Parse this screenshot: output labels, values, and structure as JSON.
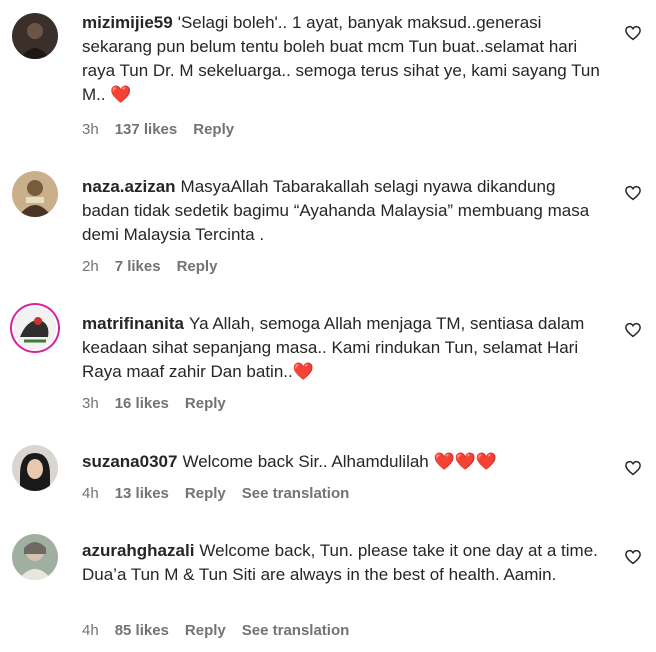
{
  "comments": [
    {
      "username": "mizimijie59",
      "text": "'Selagi boleh'.. 1 ayat, banyak maksud..generasi sekarang pun belum tentu boleh buat mcm Tun buat..selamat hari raya Tun Dr. M sekeluarga.. semoga terus sihat ye, kami sayang Tun M.. ❤️",
      "time": "3h",
      "likes": "137 likes",
      "reply": "Reply",
      "translation": ""
    },
    {
      "username": "naza.azizan",
      "text": "MasyaAllah Tabarakallah selagi nyawa dikandung badan tidak sedetik bagimu “Ayahanda Malaysia” membuang masa demi Malaysia Tercinta .",
      "time": "2h",
      "likes": "7 likes",
      "reply": "Reply",
      "translation": ""
    },
    {
      "username": "matrifinanita",
      "text": "Ya Allah, semoga Allah menjaga TM, sentiasa dalam keadaan sihat sepanjang masa.. Kami rindukan Tun, selamat Hari Raya maaf zahir Dan batin..❤️",
      "time": "3h",
      "likes": "16 likes",
      "reply": "Reply",
      "translation": ""
    },
    {
      "username": "suzana0307",
      "text": "Welcome back Sir.. Alhamdulilah ❤️❤️❤️",
      "time": "4h",
      "likes": "13 likes",
      "reply": "Reply",
      "translation": "See translation"
    },
    {
      "username": "azurahghazali",
      "text": "Welcome back, Tun. please take it one day at a time. Dua’a Tun M & Tun Siti are always in the best of health. Aamin.",
      "time": "4h",
      "likes": "85 likes",
      "reply": "Reply",
      "translation": "See translation"
    }
  ],
  "icons": {
    "like": "heart-outline-icon"
  },
  "colors": {
    "text": "#262626",
    "meta": "#737373",
    "story_ring": "#d6249f"
  }
}
